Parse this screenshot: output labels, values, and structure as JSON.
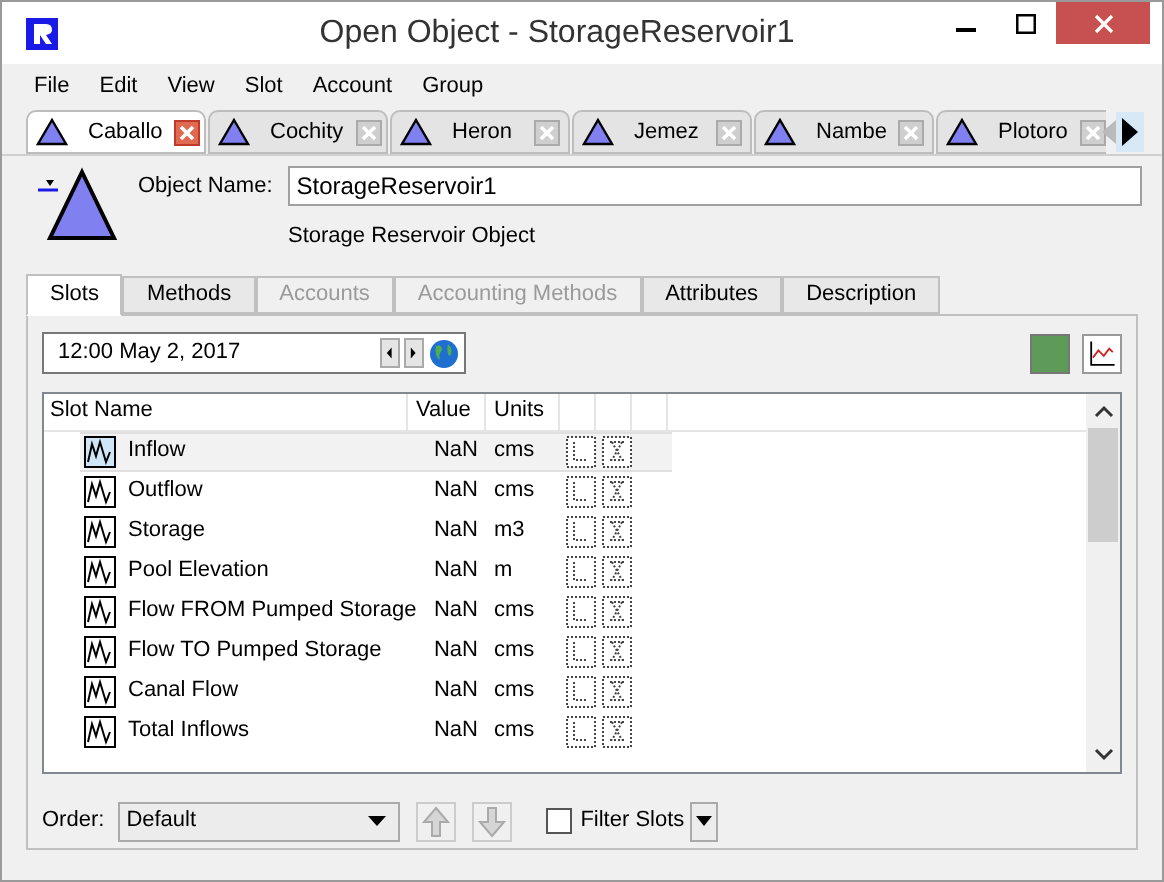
{
  "window": {
    "title": "Open Object - StorageReservoir1"
  },
  "menu": [
    "File",
    "Edit",
    "View",
    "Slot",
    "Account",
    "Group"
  ],
  "object_tabs": [
    {
      "label": "Caballo",
      "selected": true
    },
    {
      "label": "Cochity",
      "selected": false
    },
    {
      "label": "Heron",
      "selected": false
    },
    {
      "label": "Jemez",
      "selected": false
    },
    {
      "label": "Nambe",
      "selected": false
    },
    {
      "label": "Plotoro",
      "selected": false
    }
  ],
  "object_name": {
    "label": "Object Name:",
    "value": "StorageReservoir1"
  },
  "object_type": "Storage Reservoir Object",
  "panel_tabs": [
    {
      "label": "Slots",
      "selected": true,
      "disabled": false
    },
    {
      "label": "Methods",
      "selected": false,
      "disabled": false
    },
    {
      "label": "Accounts",
      "selected": false,
      "disabled": true
    },
    {
      "label": "Accounting Methods",
      "selected": false,
      "disabled": true
    },
    {
      "label": "Attributes",
      "selected": false,
      "disabled": false
    },
    {
      "label": "Description",
      "selected": false,
      "disabled": false
    }
  ],
  "date": {
    "value": "12:00 May 2, 2017"
  },
  "table": {
    "columns": [
      "Slot Name",
      "Value",
      "Units"
    ],
    "rows": [
      {
        "name": "Inflow",
        "value": "NaN",
        "units": "cms",
        "selected": true
      },
      {
        "name": "Outflow",
        "value": "NaN",
        "units": "cms",
        "selected": false
      },
      {
        "name": "Storage",
        "value": "NaN",
        "units": "m3",
        "selected": false
      },
      {
        "name": "Pool Elevation",
        "value": "NaN",
        "units": "m",
        "selected": false
      },
      {
        "name": "Flow FROM Pumped Storage",
        "value": "NaN",
        "units": "cms",
        "selected": false
      },
      {
        "name": "Flow TO Pumped Storage",
        "value": "NaN",
        "units": "cms",
        "selected": false
      },
      {
        "name": "Canal Flow",
        "value": "NaN",
        "units": "cms",
        "selected": false
      },
      {
        "name": "Total Inflows",
        "value": "NaN",
        "units": "cms",
        "selected": false
      }
    ]
  },
  "order": {
    "label": "Order:",
    "value": "Default"
  },
  "filter": {
    "label": "Filter Slots",
    "checked": false
  }
}
